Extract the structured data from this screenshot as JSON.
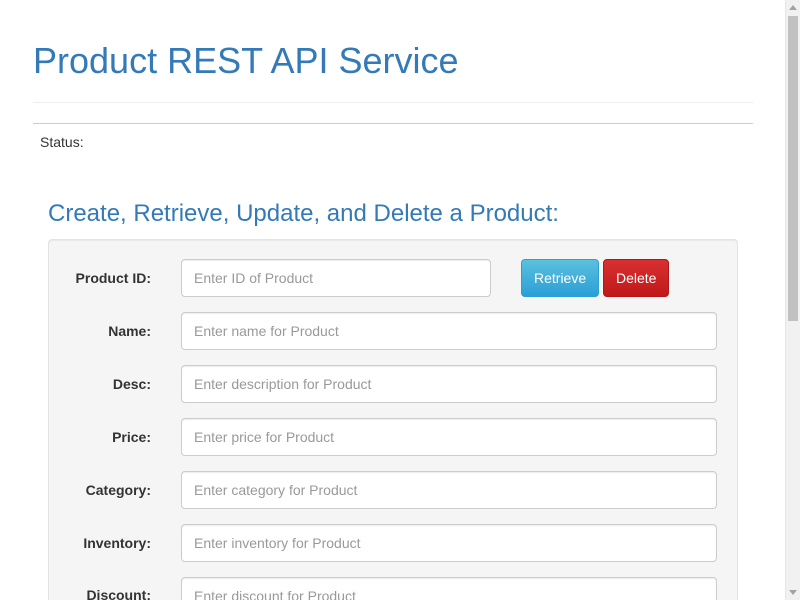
{
  "header": {
    "title": "Product REST API Service"
  },
  "status": {
    "label": "Status:"
  },
  "form": {
    "title": "Create, Retrieve, Update, and Delete a Product:",
    "fields": {
      "id": {
        "label": "Product ID:",
        "placeholder": "Enter ID of Product",
        "value": ""
      },
      "name": {
        "label": "Name:",
        "placeholder": "Enter name for Product",
        "value": ""
      },
      "desc": {
        "label": "Desc:",
        "placeholder": "Enter description for Product",
        "value": ""
      },
      "price": {
        "label": "Price:",
        "placeholder": "Enter price for Product",
        "value": ""
      },
      "category": {
        "label": "Category:",
        "placeholder": "Enter category for Product",
        "value": ""
      },
      "inventory": {
        "label": "Inventory:",
        "placeholder": "Enter inventory for Product",
        "value": ""
      },
      "discount": {
        "label": "Discount:",
        "placeholder": "Enter discount for Product",
        "value": ""
      }
    },
    "buttons": {
      "retrieve": "Retrieve",
      "delete": "Delete"
    }
  },
  "colors": {
    "heading": "#337ab7",
    "retrieve_button": "#2a9fd6",
    "delete_button": "#c0191a"
  }
}
